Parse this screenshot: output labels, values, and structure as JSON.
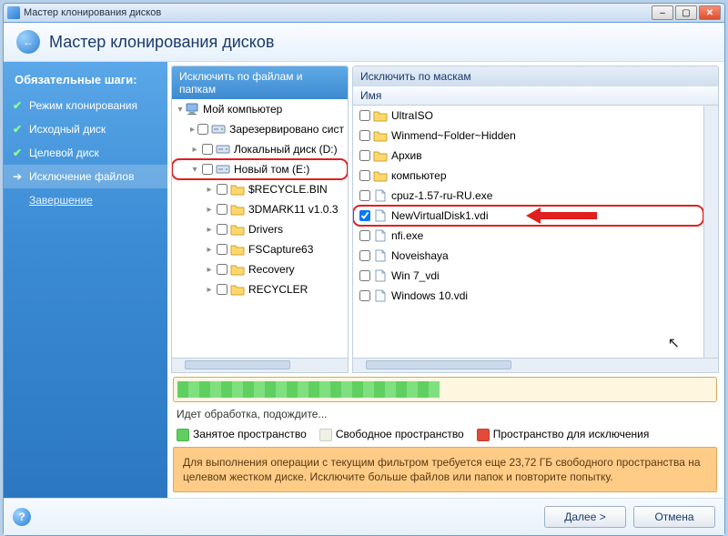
{
  "titlebar": {
    "title": "Мастер клонирования дисков"
  },
  "header": {
    "title": "Мастер клонирования дисков"
  },
  "sidebar": {
    "title": "Обязательные шаги:",
    "steps": [
      {
        "label": "Режим клонирования",
        "done": true
      },
      {
        "label": "Исходный диск",
        "done": true
      },
      {
        "label": "Целевой диск",
        "done": true
      },
      {
        "label": "Исключение файлов",
        "active": true
      },
      {
        "label": "Завершение",
        "link": true
      }
    ]
  },
  "tabs": {
    "tree_tab": "Исключить по файлам и папкам",
    "list_tab": "Исключить по маскам",
    "name_col": "Имя"
  },
  "tree": [
    {
      "indent": 0,
      "expander": "▾",
      "icon": "computer",
      "label": "Мой компьютер",
      "nocb": true
    },
    {
      "indent": 1,
      "expander": "▸",
      "icon": "drive",
      "label": "Зарезервировано сист"
    },
    {
      "indent": 1,
      "expander": "▸",
      "icon": "drive",
      "label": "Локальный диск (D:)"
    },
    {
      "indent": 1,
      "expander": "▾",
      "icon": "drive",
      "label": "Новый том (E:)",
      "highlight": true
    },
    {
      "indent": 2,
      "expander": "▸",
      "icon": "folder",
      "label": "$RECYCLE.BIN"
    },
    {
      "indent": 2,
      "expander": "▸",
      "icon": "folder",
      "label": "3DMARK11 v1.0.3"
    },
    {
      "indent": 2,
      "expander": "▸",
      "icon": "folder",
      "label": "Drivers"
    },
    {
      "indent": 2,
      "expander": "▸",
      "icon": "folder",
      "label": "FSCapture63"
    },
    {
      "indent": 2,
      "expander": "▸",
      "icon": "folder",
      "label": "Recovery"
    },
    {
      "indent": 2,
      "expander": "▸",
      "icon": "folder",
      "label": "RECYCLER"
    }
  ],
  "list": [
    {
      "icon": "folder",
      "label": "UltraISO"
    },
    {
      "icon": "folder",
      "label": "Winmend~Folder~Hidden"
    },
    {
      "icon": "folder",
      "label": "Архив"
    },
    {
      "icon": "folder",
      "label": "компьютер"
    },
    {
      "icon": "file",
      "label": "cpuz-1.57-ru-RU.exe"
    },
    {
      "icon": "file",
      "label": "NewVirtualDisk1.vdi",
      "checked": true,
      "highlight": true,
      "arrow": true
    },
    {
      "icon": "file",
      "label": "nfi.exe"
    },
    {
      "icon": "file",
      "label": "Noveishaya"
    },
    {
      "icon": "file",
      "label": "Win 7_vdi"
    },
    {
      "icon": "file",
      "label": "Windows 10.vdi"
    }
  ],
  "status": {
    "text": "Идет обработка, подождите..."
  },
  "legend": {
    "used": "Занятое пространство",
    "free": "Свободное пространство",
    "excl": "Пространство для исключения"
  },
  "warning": "Для выполнения операции с текущим фильтром требуется еще 23,72 ГБ свободного пространства на целевом жестком диске. Исключите больше файлов или папок и повторите попытку.",
  "footer": {
    "next": "Далее >",
    "cancel": "Отмена"
  }
}
